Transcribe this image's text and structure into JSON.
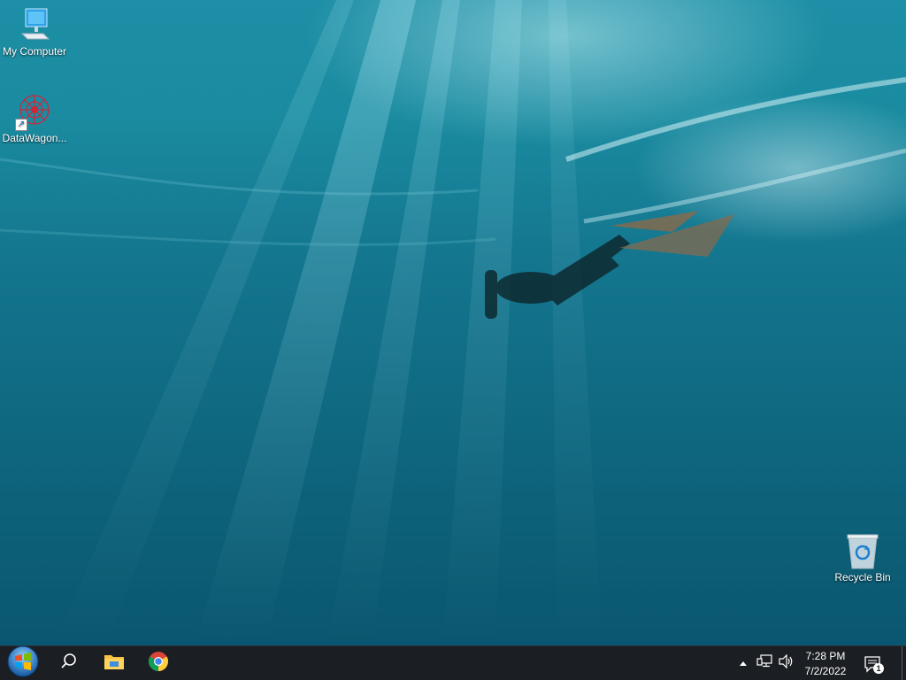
{
  "desktop": {
    "icons": [
      {
        "label": "My Computer",
        "icon": "computer-icon"
      },
      {
        "label": "DataWagon...",
        "icon": "datawagon-icon"
      },
      {
        "label": "Recycle Bin",
        "icon": "recycle-bin-icon"
      }
    ]
  },
  "taskbar": {
    "start": {
      "icon": "windows-start-icon"
    },
    "search": {
      "icon": "search-icon"
    },
    "pinned": [
      {
        "icon": "file-explorer-icon"
      },
      {
        "icon": "chrome-icon"
      }
    ],
    "tray": {
      "overflow_icon": "chevron-up-icon",
      "network_icon": "network-icon",
      "volume_icon": "volume-icon",
      "time": "7:28 PM",
      "date": "7/2/2022",
      "notifications_icon": "notification-icon",
      "notification_count": "1"
    }
  },
  "colors": {
    "taskbar": "#1b1e22",
    "water_top": "#1d8fa6",
    "water_bottom": "#0a5670"
  }
}
